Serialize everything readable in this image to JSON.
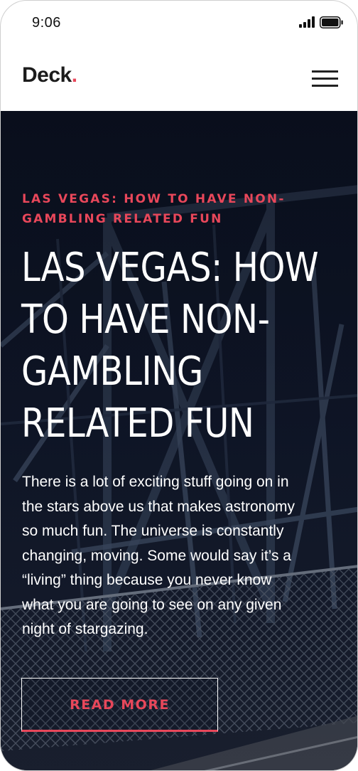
{
  "status_bar": {
    "time": "9:06",
    "icons": [
      "signal-icon",
      "battery-icon"
    ]
  },
  "header": {
    "logo_text": "Deck",
    "logo_dot": ".",
    "menu_icon": "hamburger-menu-icon"
  },
  "hero": {
    "background_image": "bridge-at-night-photo",
    "eyebrow": "LAS VEGAS: HOW TO HAVE NON-GAMBLING RELATED FUN",
    "title_lines": [
      "LAS VEGAS: HOW",
      "TO HAVE NON-",
      "GAMBLING",
      "RELATED FUN"
    ],
    "body_lines": [
      "There is a lot of exciting stuff going on in",
      "the stars above us that makes astronomy",
      "so much fun. The universe is constantly",
      "changing, moving. Some would say it’s a",
      "“living” thing because you never know",
      "what you are going to see on any given",
      "night of stargazing."
    ],
    "button_label": "READ MORE"
  },
  "colors": {
    "accent": "#e8475a",
    "hero_text": "#ffffff",
    "logo_text": "#1c1c1c"
  }
}
